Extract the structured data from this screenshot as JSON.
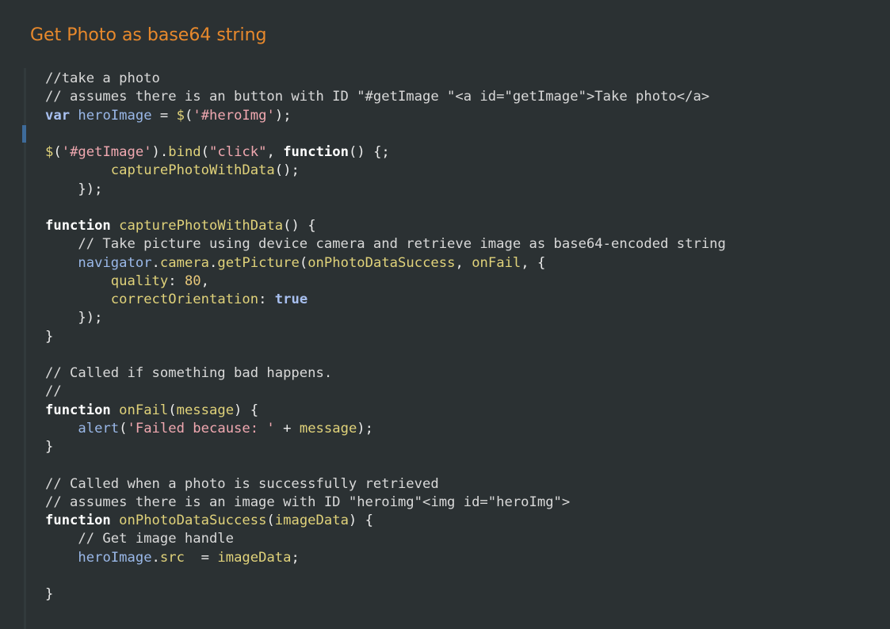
{
  "page": {
    "title": "Get Photo as base64 string"
  },
  "code": {
    "lines": [
      "//take a photo",
      "// assumes there is an button with ID \"#getImage \"<a id=\"getImage\">Take photo</a>",
      "var heroImage = $('#heroImg');",
      "",
      "$('#getImage').bind(\"click\", function() {;",
      "        capturePhotoWithData();",
      "    });",
      "",
      "function capturePhotoWithData() {",
      "    // Take picture using device camera and retrieve image as base64-encoded string",
      "    navigator.camera.getPicture(onPhotoDataSuccess, onFail, {",
      "        quality: 80,",
      "        correctOrientation: true",
      "    });",
      "}",
      "",
      "// Called if something bad happens.",
      "//",
      "function onFail(message) {",
      "    alert('Failed because: ' + message);",
      "}",
      "",
      "// Called when a photo is successfully retrieved",
      "// assumes there is an image with ID \"heroimg\"<img id=\"heroImg\">",
      "function onPhotoDataSuccess(imageData) {",
      "    // Get image handle",
      "    heroImage.src  = imageData;",
      "",
      "}"
    ]
  },
  "colors": {
    "background": "#2b3133",
    "heading": "#e8892c",
    "cursor_marker": "#3e6b9a"
  }
}
